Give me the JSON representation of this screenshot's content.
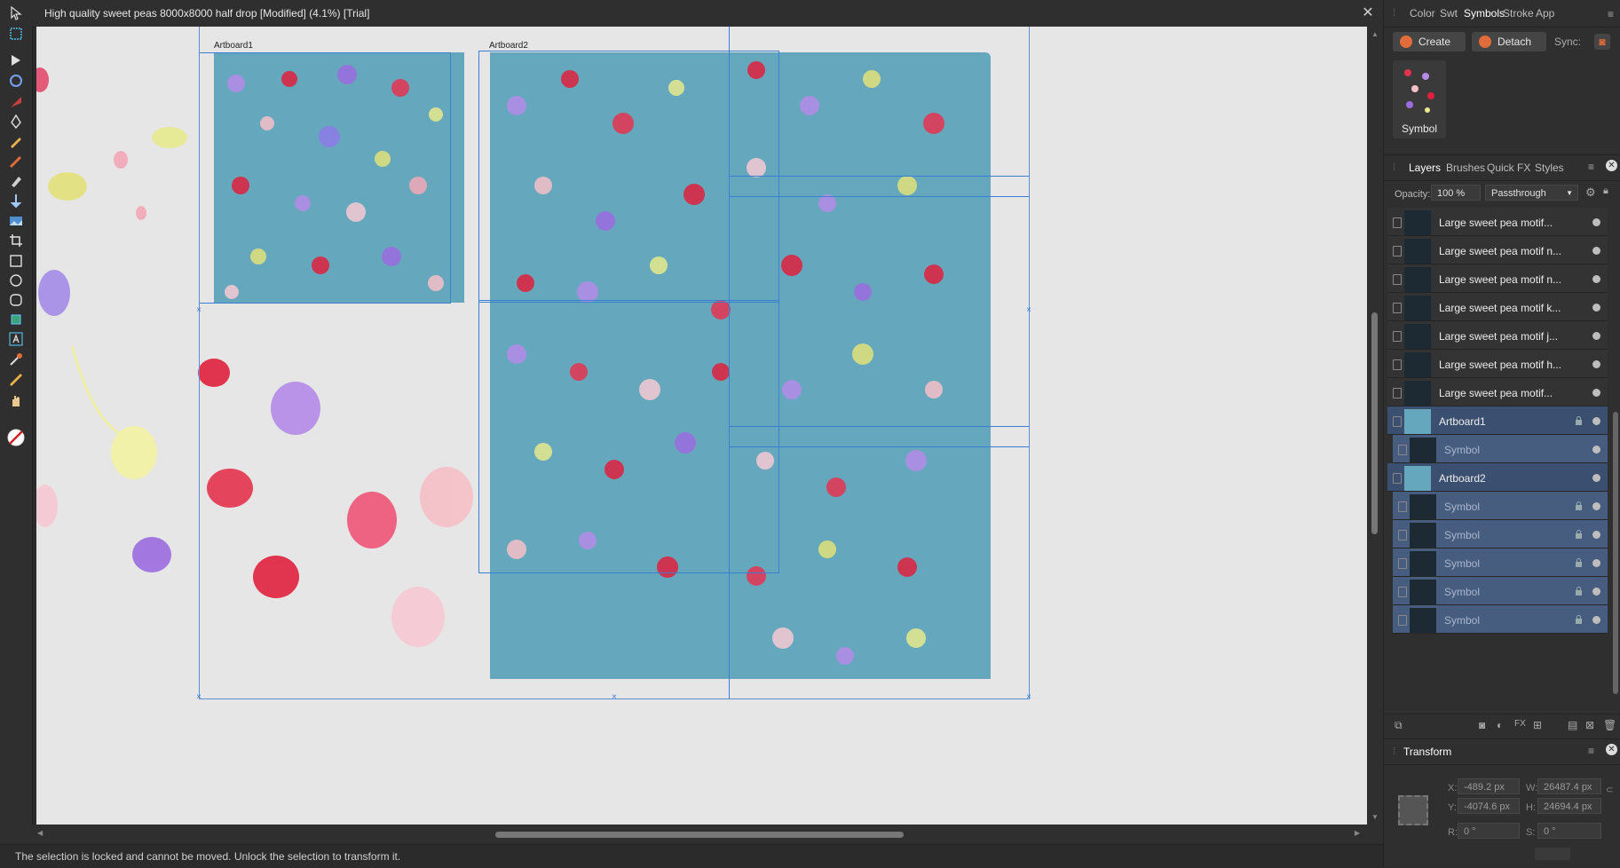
{
  "document": {
    "title": "High quality sweet peas 8000x8000 half drop [Modified] (4.1%) [Trial]"
  },
  "canvas": {
    "artboard1_label": "Artboard1",
    "artboard2_label": "Artboard2",
    "background_color": "#e6e6e6",
    "artboard_color": "#65a8bd",
    "guide_color": "#3a7fd0"
  },
  "status": {
    "message": "The selection is locked and cannot be moved. Unlock the selection to transform it."
  },
  "top_tabs": [
    "Color",
    "Swt",
    "Symbols",
    "Stroke",
    "App"
  ],
  "symbols_panel": {
    "create_label": "Create",
    "detach_label": "Detach",
    "sync_label": "Sync:",
    "symbol_name": "Symbol"
  },
  "layers_tabs": [
    "Layers",
    "Brushes",
    "Quick FX",
    "Styles"
  ],
  "layers_panel": {
    "opacity_label": "Opacity:",
    "opacity_value": "100 %",
    "blend_mode": "Passthrough",
    "layers": [
      {
        "name": "Large sweet pea motif...",
        "type": "motif",
        "selected": false,
        "locked": false
      },
      {
        "name": "Large sweet pea motif n...",
        "type": "motif",
        "selected": false,
        "locked": false
      },
      {
        "name": "Large sweet pea motif n...",
        "type": "motif",
        "selected": false,
        "locked": false
      },
      {
        "name": "Large sweet pea motif k...",
        "type": "motif",
        "selected": false,
        "locked": false
      },
      {
        "name": "Large sweet pea motif j...",
        "type": "motif",
        "selected": false,
        "locked": false
      },
      {
        "name": "Large sweet pea motif h...",
        "type": "motif",
        "selected": false,
        "locked": false
      },
      {
        "name": "Large sweet pea motif...",
        "type": "motif",
        "selected": false,
        "locked": false
      },
      {
        "name": "Artboard1",
        "type": "artboard",
        "selected": true,
        "locked": true
      },
      {
        "name": "Symbol",
        "type": "symbol",
        "selected": true,
        "locked": false
      },
      {
        "name": "Artboard2",
        "type": "artboard",
        "selected": true,
        "locked": false
      },
      {
        "name": "Symbol",
        "type": "symbol",
        "selected": true,
        "locked": true
      },
      {
        "name": "Symbol",
        "type": "symbol",
        "selected": true,
        "locked": true
      },
      {
        "name": "Symbol",
        "type": "symbol",
        "selected": true,
        "locked": true
      },
      {
        "name": "Symbol",
        "type": "symbol",
        "selected": true,
        "locked": true
      },
      {
        "name": "Symbol",
        "type": "symbol",
        "selected": true,
        "locked": true
      }
    ]
  },
  "transform_panel": {
    "title": "Transform",
    "x_label": "X:",
    "x_value": "-489.2 px",
    "y_label": "Y:",
    "y_value": "-4074.6 px",
    "w_label": "W:",
    "w_value": "26487.4 px",
    "h_label": "H:",
    "h_value": "24694.4 px",
    "r_label": "R:",
    "r_value": "0 °",
    "s_label": "S:",
    "s_value": "0 °"
  }
}
